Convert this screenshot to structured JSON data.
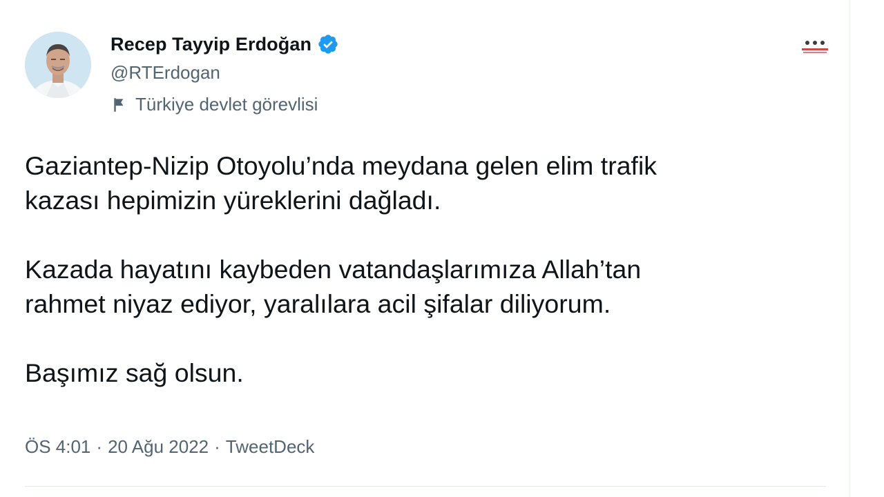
{
  "tweet": {
    "author": {
      "name": "Recep Tayyip Erdoğan",
      "handle": "@RTErdogan",
      "label": "Türkiye devlet görevlisi",
      "avatar_icon": "profile-photo",
      "verified_icon": "verified-badge-icon",
      "label_icon": "flag-icon"
    },
    "paragraphs": [
      {
        "lines": [
          "Gaziantep-Nizip Otoyolu’nda meydana gelen elim trafik",
          "kazası hepimizin yüreklerini dağladı."
        ]
      },
      {
        "lines": [
          "Kazada hayatını kaybeden vatandaşlarımıza Allah’tan",
          "rahmet niyaz ediyor, yaralılara acil şifalar diliyorum."
        ]
      },
      {
        "lines": [
          "Başımız sağ olsun."
        ]
      }
    ],
    "meta": {
      "time": "ÖS 4:01",
      "separator": "·",
      "date": "20 Ağu 2022",
      "source": "TweetDeck"
    },
    "more_icon": "more-options-icon"
  },
  "colors": {
    "text_primary": "#0f1419",
    "text_secondary": "#536471",
    "verified_blue": "#1d9bf0",
    "more_red": "#c62828"
  }
}
